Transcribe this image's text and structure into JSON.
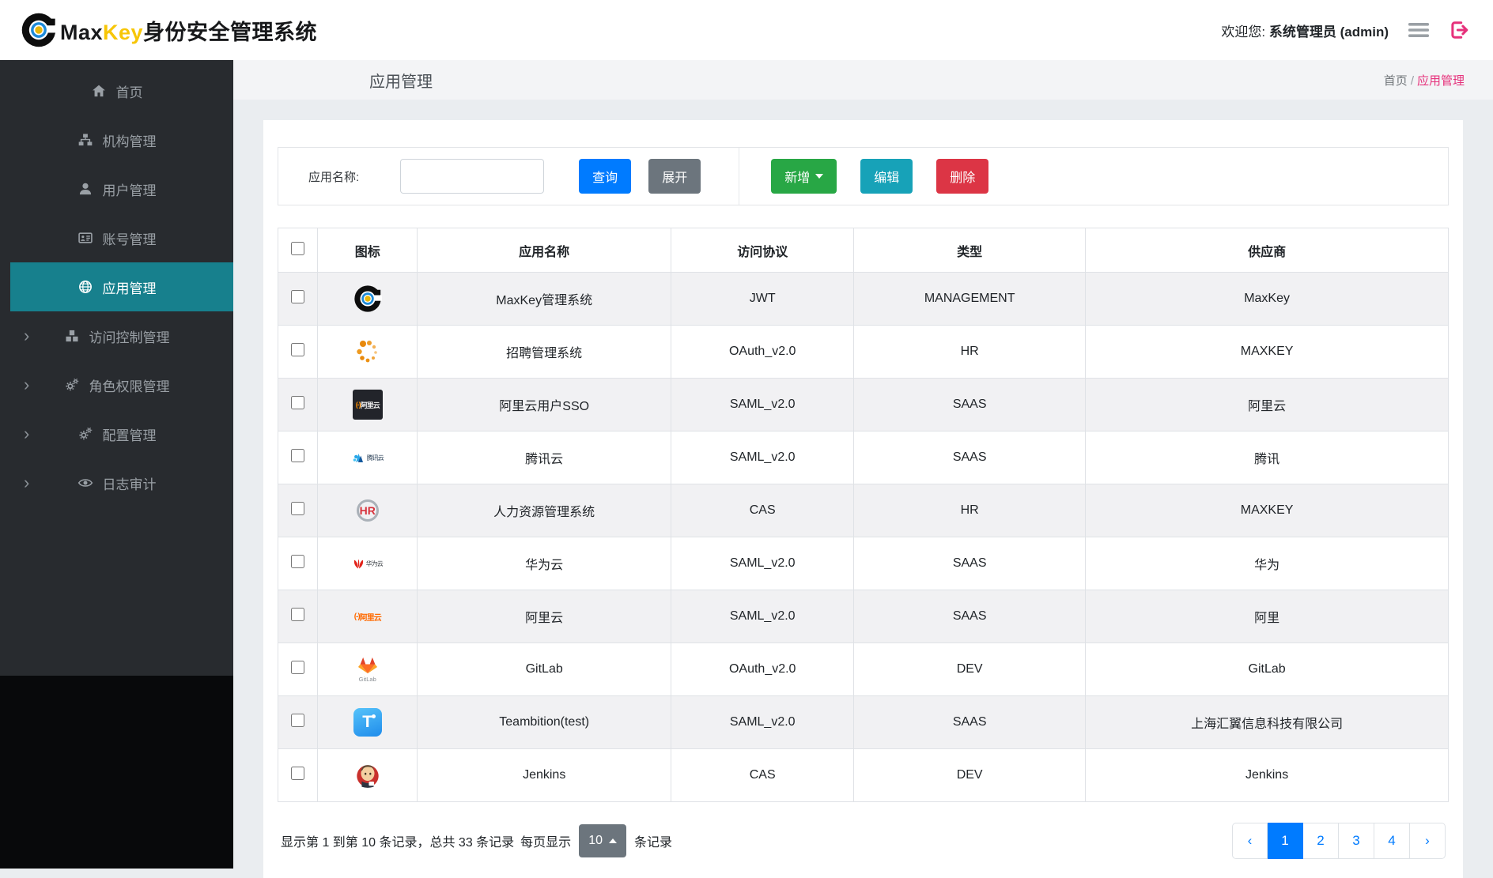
{
  "colors": {
    "primary": "#007bff",
    "secondary": "#6c757d",
    "success": "#28a745",
    "info": "#17a2b8",
    "danger": "#dc3545",
    "breadcrumb_pink": "#e6317b",
    "menu_active_teal": "#17808d",
    "brand_yellow": "#f7c607"
  },
  "header": {
    "brand_max": "Max",
    "brand_key": "Key",
    "brand_rest": "身份安全管理系统",
    "welcome_prefix": "欢迎您:",
    "user": "系统管理员 (admin)"
  },
  "sidebar": {
    "items": [
      {
        "key": "home",
        "label": "首页",
        "icon": "home-icon",
        "active": false,
        "expandable": false
      },
      {
        "key": "org",
        "label": "机构管理",
        "icon": "sitemap-icon",
        "active": false,
        "expandable": false
      },
      {
        "key": "user",
        "label": "用户管理",
        "icon": "user-icon",
        "active": false,
        "expandable": false
      },
      {
        "key": "account",
        "label": "账号管理",
        "icon": "id-card-icon",
        "active": false,
        "expandable": false
      },
      {
        "key": "app",
        "label": "应用管理",
        "icon": "globe-icon",
        "active": true,
        "expandable": false
      },
      {
        "key": "access",
        "label": "访问控制管理",
        "icon": "cubes-icon",
        "active": false,
        "expandable": true
      },
      {
        "key": "role",
        "label": "角色权限管理",
        "icon": "gears-icon",
        "active": false,
        "expandable": true
      },
      {
        "key": "config",
        "label": "配置管理",
        "icon": "gears-icon",
        "active": false,
        "expandable": true
      },
      {
        "key": "audit",
        "label": "日志审计",
        "icon": "eye-icon",
        "active": false,
        "expandable": true
      }
    ]
  },
  "page": {
    "title": "应用管理",
    "breadcrumb_home": "首页",
    "breadcrumb_sep": "/",
    "breadcrumb_current": "应用管理"
  },
  "toolbar": {
    "search_label": "应用名称:",
    "search_value": "",
    "query": "查询",
    "expand": "展开",
    "add": "新增",
    "edit": "编辑",
    "delete": "删除"
  },
  "table": {
    "columns": [
      "图标",
      "应用名称",
      "访问协议",
      "类型",
      "供应商"
    ],
    "rows": [
      {
        "icon": "maxkey-logo-icon",
        "name": "MaxKey管理系统",
        "protocol": "JWT",
        "type": "MANAGEMENT",
        "vendor": "MaxKey"
      },
      {
        "icon": "spinner-dots-icon",
        "name": "招聘管理系统",
        "protocol": "OAuth_v2.0",
        "type": "HR",
        "vendor": "MAXKEY"
      },
      {
        "icon": "aliyun-dark-icon",
        "name": "阿里云用户SSO",
        "protocol": "SAML_v2.0",
        "type": "SAAS",
        "vendor": "阿里云"
      },
      {
        "icon": "tencent-cloud-icon",
        "name": "腾讯云",
        "protocol": "SAML_v2.0",
        "type": "SAAS",
        "vendor": "腾讯"
      },
      {
        "icon": "hr-system-icon",
        "name": "人力资源管理系统",
        "protocol": "CAS",
        "type": "HR",
        "vendor": "MAXKEY"
      },
      {
        "icon": "huawei-cloud-icon",
        "name": "华为云",
        "protocol": "SAML_v2.0",
        "type": "SAAS",
        "vendor": "华为"
      },
      {
        "icon": "aliyun-light-icon",
        "name": "阿里云",
        "protocol": "SAML_v2.0",
        "type": "SAAS",
        "vendor": "阿里"
      },
      {
        "icon": "gitlab-icon",
        "name": "GitLab",
        "protocol": "OAuth_v2.0",
        "type": "DEV",
        "vendor": "GitLab"
      },
      {
        "icon": "teambition-icon",
        "name": "Teambition(test)",
        "protocol": "SAML_v2.0",
        "type": "SAAS",
        "vendor": "上海汇翼信息科技有限公司"
      },
      {
        "icon": "jenkins-icon",
        "name": "Jenkins",
        "protocol": "CAS",
        "type": "DEV",
        "vendor": "Jenkins"
      }
    ],
    "icon_texts": {
      "aliyun_bracket": "(-)",
      "aliyun_text": "阿里云",
      "tencent_text": "腾讯云",
      "huawei_text": "华为云",
      "hr_text": "HR",
      "gitlab_text": "GitLab",
      "teambition_letter": "T"
    }
  },
  "pagination": {
    "info": "显示第 1 到第 10 条记录，总共 33 条记录",
    "per_page_label": "每页显示",
    "per_page_value": "10",
    "per_page_suffix": "条记录",
    "prev": "‹",
    "pages": [
      "1",
      "2",
      "3",
      "4"
    ],
    "active_page": "1",
    "next": "›"
  }
}
